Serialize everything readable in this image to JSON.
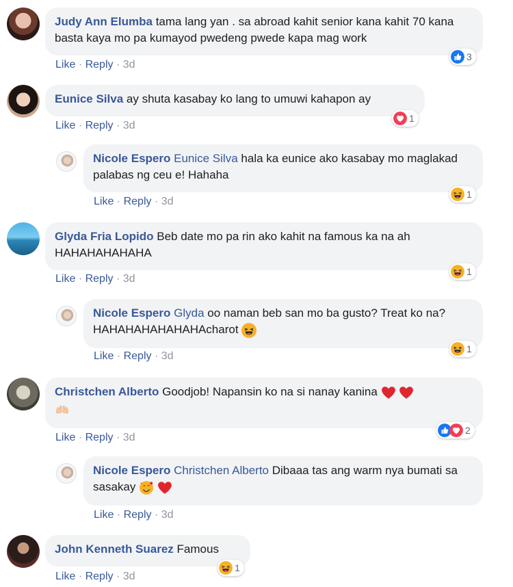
{
  "actions": {
    "like": "Like",
    "reply": "Reply",
    "sep": "·"
  },
  "comments": [
    {
      "name": "Judy Ann Elumba",
      "text": "tama lang yan . sa abroad kahit senior kana kahit 70 kana basta kaya mo pa kumayod pwedeng pwede kapa mag work",
      "time": "3d",
      "reaction_icons": [
        "like-icon"
      ],
      "reaction_count": "3"
    },
    {
      "name": "Eunice Silva",
      "text": "ay shuta kasabay ko lang to umuwi kahapon ay",
      "time": "3d",
      "reaction_icons": [
        "love-icon"
      ],
      "reaction_count": "1"
    },
    {
      "name": "Nicole Espero",
      "mention": "Eunice Silva",
      "text": "hala ka eunice ako kasabay mo maglakad palabas ng ceu e! Hahaha",
      "time": "3d",
      "reaction_icons": [
        "haha-icon"
      ],
      "reaction_count": "1"
    },
    {
      "name": "Glyda Fria Lopido",
      "text": "Beb date mo pa rin ako kahit na famous ka na ah HAHAHAHAHAHA",
      "time": "3d",
      "reaction_icons": [
        "haha-icon"
      ],
      "reaction_count": "1"
    },
    {
      "name": "Nicole Espero",
      "mention": "Glyda",
      "text": "oo naman beb san mo ba gusto? Treat ko na? HAHAHAHAHAHAHAcharot",
      "time": "3d",
      "reaction_icons": [
        "haha-icon"
      ],
      "reaction_count": "1"
    },
    {
      "name": "Christchen Alberto",
      "text": "Goodjob! Napansin ko na si nanay kanina",
      "time": "3d",
      "reaction_icons": [
        "like-icon",
        "love-icon"
      ],
      "reaction_count": "2"
    },
    {
      "name": "Nicole Espero",
      "mention": "Christchen Alberto",
      "text": "Dibaaa tas ang warm nya bumati sa sasakay",
      "time": "3d",
      "reaction_icons": [],
      "reaction_count": ""
    },
    {
      "name": "John Kenneth Suarez",
      "text": "Famous",
      "time": "3d",
      "reaction_icons": [
        "haha-icon"
      ],
      "reaction_count": "1"
    }
  ],
  "colors": {
    "name": "#385898",
    "bubble": "#f2f3f5",
    "like": "#1877f2",
    "love": "#f33e58",
    "haha": "#f7b125",
    "meta": "#90949c"
  }
}
